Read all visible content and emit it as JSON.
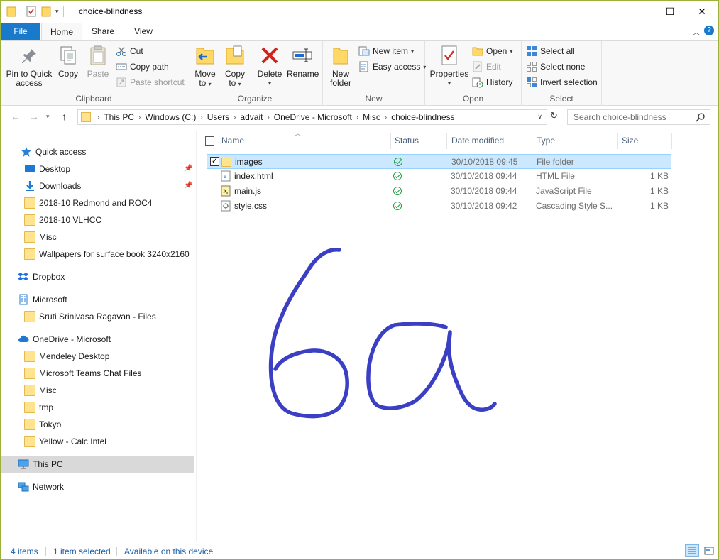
{
  "window": {
    "title": "choice-blindness",
    "controls": {
      "minimize": "—",
      "maximize": "☐",
      "close": "✕"
    }
  },
  "ribbon_tabs": {
    "file": "File",
    "home": "Home",
    "share": "Share",
    "view": "View"
  },
  "ribbon": {
    "clipboard": {
      "label": "Clipboard",
      "pin_to_quick_access": [
        "Pin to Quick",
        "access"
      ],
      "copy": "Copy",
      "paste": "Paste",
      "cut": "Cut",
      "copy_path": "Copy path",
      "paste_shortcut": "Paste shortcut"
    },
    "organize": {
      "label": "Organize",
      "move_to": [
        "Move",
        "to"
      ],
      "copy_to": [
        "Copy",
        "to"
      ],
      "delete": "Delete",
      "rename": "Rename"
    },
    "new": {
      "label": "New",
      "new_folder": [
        "New",
        "folder"
      ],
      "new_item": "New item",
      "easy_access": "Easy access"
    },
    "open": {
      "label": "Open",
      "properties": "Properties",
      "open": "Open",
      "edit": "Edit",
      "history": "History"
    },
    "select": {
      "label": "Select",
      "select_all": "Select all",
      "select_none": "Select none",
      "invert_selection": "Invert selection"
    }
  },
  "address": {
    "breadcrumbs": [
      "This PC",
      "Windows (C:)",
      "Users",
      "advait",
      "OneDrive - Microsoft",
      "Misc",
      "choice-blindness"
    ],
    "search_placeholder": "Search choice-blindness"
  },
  "sidebar": {
    "quick_access": {
      "label": "Quick access",
      "items": [
        {
          "label": "Desktop",
          "pinned": true
        },
        {
          "label": "Downloads",
          "pinned": true
        },
        {
          "label": "2018-10 Redmond and ROC4"
        },
        {
          "label": "2018-10 VLHCC"
        },
        {
          "label": "Misc"
        },
        {
          "label": "Wallpapers for surface book 3240x2160"
        }
      ]
    },
    "dropbox": "Dropbox",
    "microsoft": {
      "label": "Microsoft",
      "items": [
        {
          "label": "Sruti Srinivasa Ragavan - Files"
        }
      ]
    },
    "onedrive": {
      "label": "OneDrive - Microsoft",
      "items": [
        {
          "label": "Mendeley Desktop"
        },
        {
          "label": "Microsoft Teams Chat Files"
        },
        {
          "label": "Misc"
        },
        {
          "label": "tmp"
        },
        {
          "label": "Tokyo"
        },
        {
          "label": "Yellow - Calc Intel"
        }
      ]
    },
    "this_pc": "This PC",
    "network": "Network"
  },
  "columns": {
    "name": "Name",
    "status": "Status",
    "date_modified": "Date modified",
    "type": "Type",
    "size": "Size"
  },
  "files": [
    {
      "name": "images",
      "date": "30/10/2018 09:45",
      "type": "File folder",
      "size": "",
      "selected": true
    },
    {
      "name": "index.html",
      "date": "30/10/2018 09:44",
      "type": "HTML File",
      "size": "1 KB"
    },
    {
      "name": "main.js",
      "date": "30/10/2018 09:44",
      "type": "JavaScript File",
      "size": "1 KB"
    },
    {
      "name": "style.css",
      "date": "30/10/2018 09:42",
      "type": "Cascading Style S...",
      "size": "1 KB"
    }
  ],
  "statusbar": {
    "item_count": "4 items",
    "selection": "1 item selected",
    "availability": "Available on this device"
  },
  "colors": {
    "accent": "#1979ca",
    "window_border": "#9cb13a",
    "ink": "#3b3fc4",
    "selection": "#cce8ff"
  }
}
